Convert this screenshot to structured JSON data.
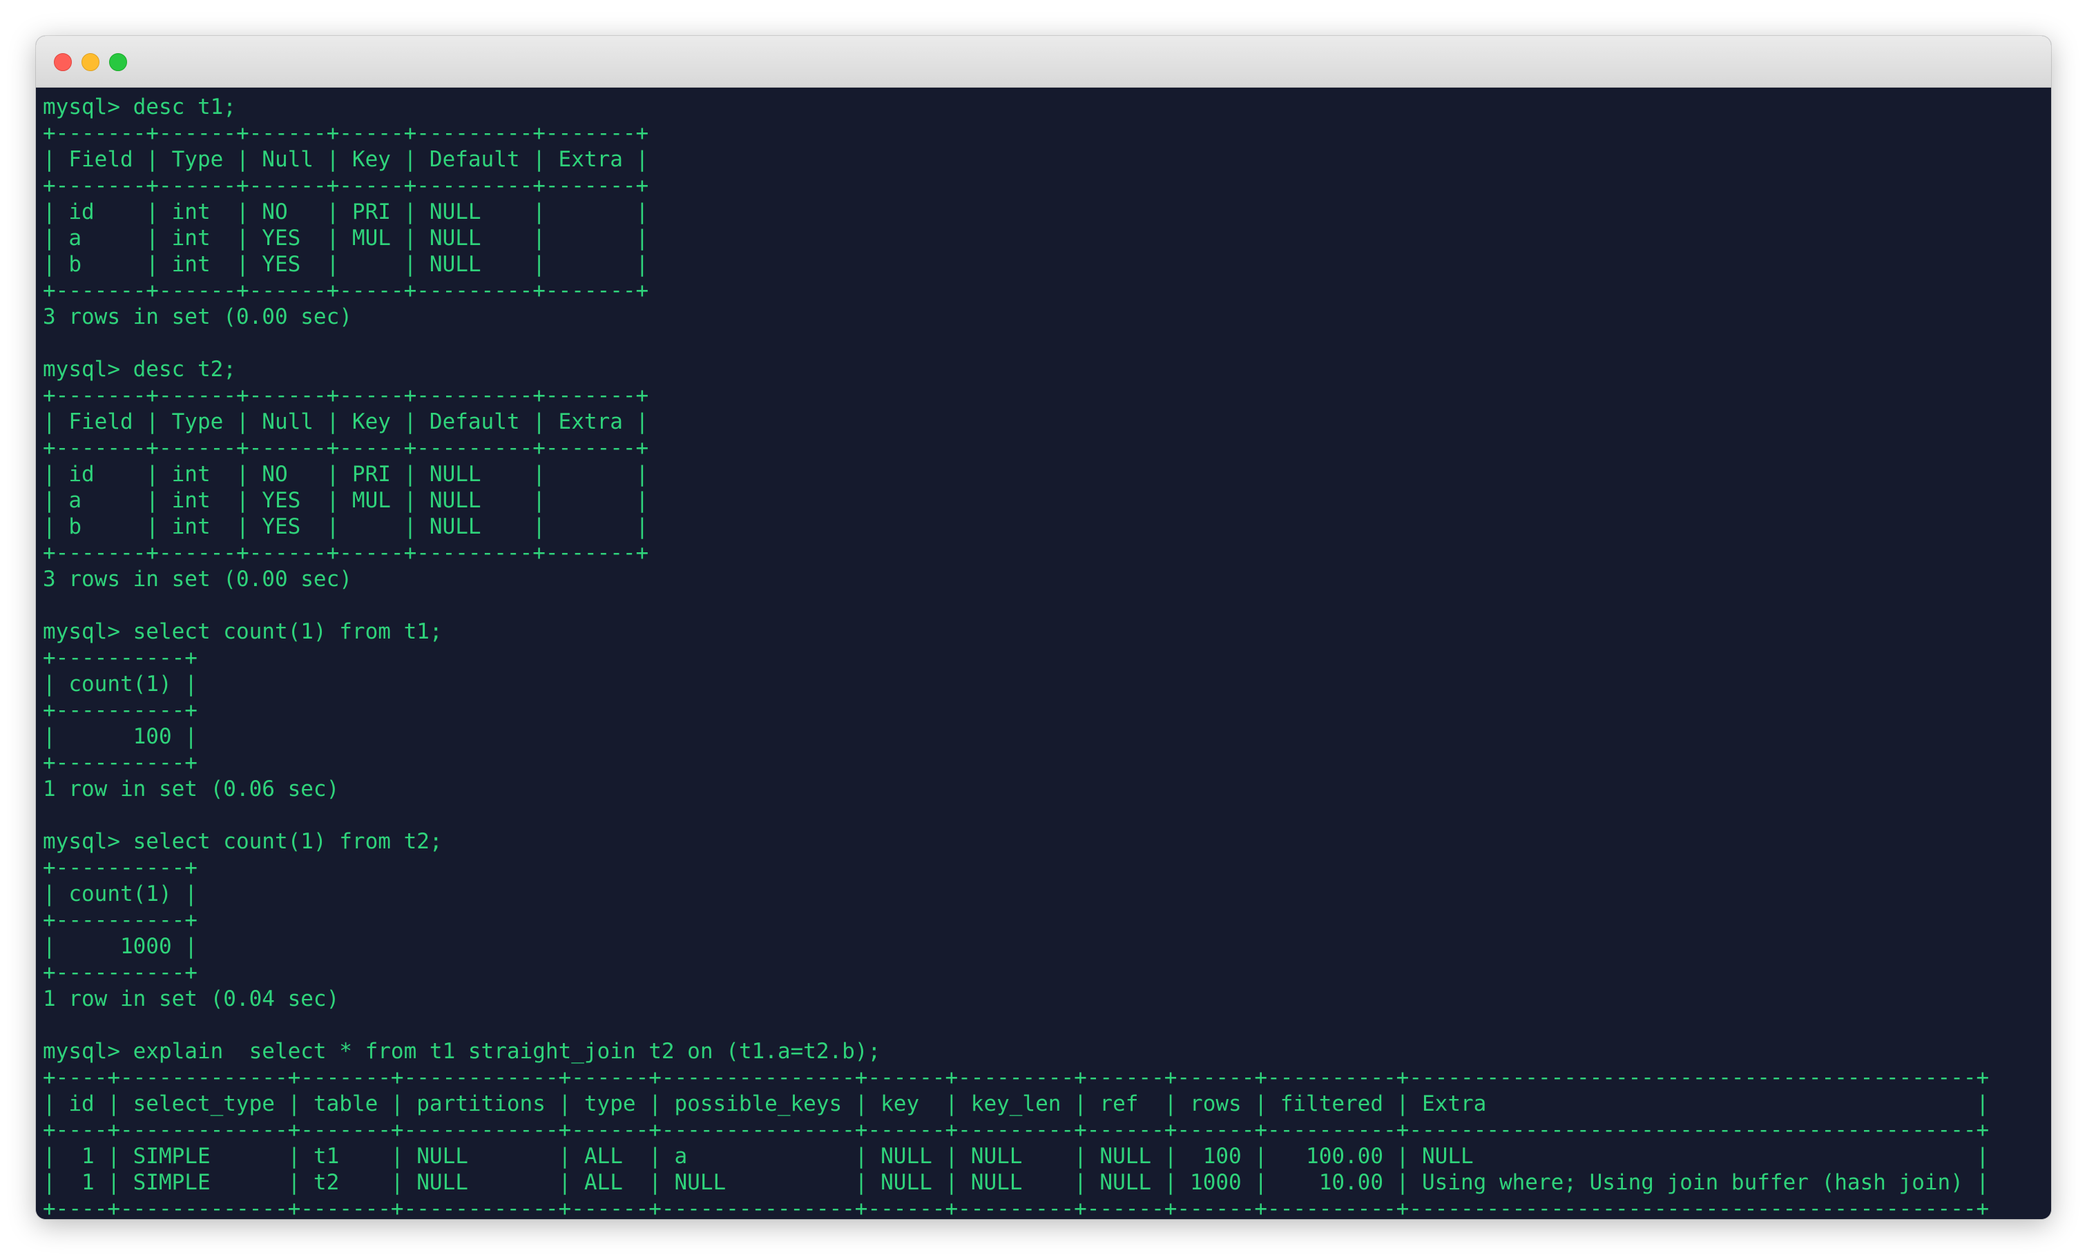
{
  "window": {
    "title": ""
  },
  "colors": {
    "terminal_background": "#151a2d",
    "terminal_text": "#2fd37b",
    "traffic_red": "#fe5f57",
    "traffic_yellow": "#febc2e",
    "traffic_green": "#28c840"
  },
  "terminal": {
    "lines": [
      "mysql> desc t1;",
      "+-------+------+------+-----+---------+-------+",
      "| Field | Type | Null | Key | Default | Extra |",
      "+-------+------+------+-----+---------+-------+",
      "| id    | int  | NO   | PRI | NULL    |       |",
      "| a     | int  | YES  | MUL | NULL    |       |",
      "| b     | int  | YES  |     | NULL    |       |",
      "+-------+------+------+-----+---------+-------+",
      "3 rows in set (0.00 sec)",
      "",
      "mysql> desc t2;",
      "+-------+------+------+-----+---------+-------+",
      "| Field | Type | Null | Key | Default | Extra |",
      "+-------+------+------+-----+---------+-------+",
      "| id    | int  | NO   | PRI | NULL    |       |",
      "| a     | int  | YES  | MUL | NULL    |       |",
      "| b     | int  | YES  |     | NULL    |       |",
      "+-------+------+------+-----+---------+-------+",
      "3 rows in set (0.00 sec)",
      "",
      "mysql> select count(1) from t1;",
      "+----------+",
      "| count(1) |",
      "+----------+",
      "|      100 |",
      "+----------+",
      "1 row in set (0.06 sec)",
      "",
      "mysql> select count(1) from t2;",
      "+----------+",
      "| count(1) |",
      "+----------+",
      "|     1000 |",
      "+----------+",
      "1 row in set (0.04 sec)",
      "",
      "mysql> explain  select * from t1 straight_join t2 on (t1.a=t2.b);",
      "+----+-------------+-------+------------+------+---------------+------+---------+------+------+----------+--------------------------------------------+",
      "| id | select_type | table | partitions | type | possible_keys | key  | key_len | ref  | rows | filtered | Extra                                      |",
      "+----+-------------+-------+------------+------+---------------+------+---------+------+------+----------+--------------------------------------------+",
      "|  1 | SIMPLE      | t1    | NULL       | ALL  | a             | NULL | NULL    | NULL |  100 |   100.00 | NULL                                       |",
      "|  1 | SIMPLE      | t2    | NULL       | ALL  | NULL          | NULL | NULL    | NULL | 1000 |    10.00 | Using where; Using join buffer (hash join) |",
      "+----+-------------+-------+------------+------+---------------+------+---------+------+------+----------+--------------------------------------------+"
    ]
  }
}
